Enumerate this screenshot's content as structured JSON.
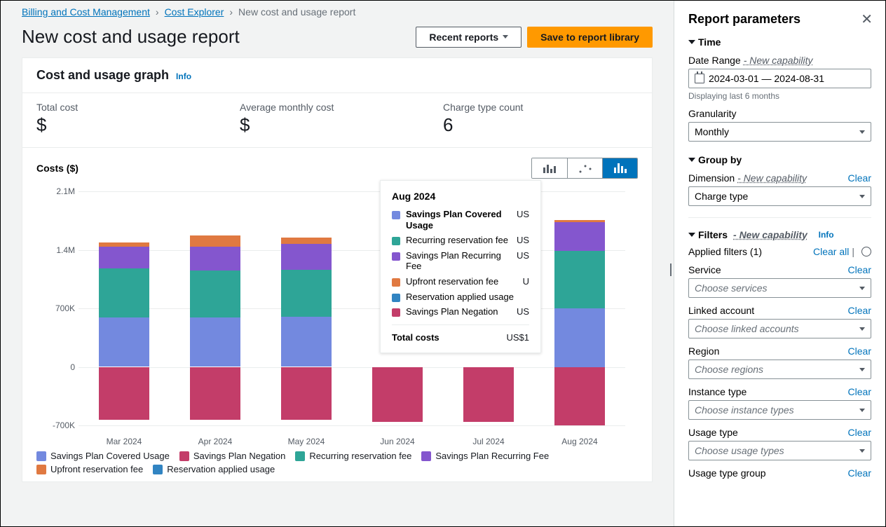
{
  "breadcrumb": {
    "root": "Billing and Cost Management",
    "mid": "Cost Explorer",
    "cur": "New cost and usage report"
  },
  "page": {
    "title": "New cost and usage report",
    "recent_btn": "Recent reports",
    "save_btn": "Save to report library"
  },
  "card": {
    "title": "Cost and usage graph",
    "info": "Info"
  },
  "kpis": [
    {
      "lab": "Total cost",
      "val": "$"
    },
    {
      "lab": "Average monthly cost",
      "val": "$"
    },
    {
      "lab": "Charge type count",
      "val": "6"
    }
  ],
  "chart": {
    "ytitle": "Costs ($)"
  },
  "chart_data": {
    "type": "bar",
    "stacked": true,
    "ylabel": "Costs ($)",
    "xlabel": "",
    "ylim": [
      -700000,
      2100000
    ],
    "yticks": [
      -700000,
      0,
      700000,
      1400000,
      2100000
    ],
    "ytick_labels": [
      "-700K",
      "0",
      "700K",
      "1.4M",
      "2.1M"
    ],
    "categories": [
      "Mar 2024",
      "Apr 2024",
      "May 2024",
      "Jun 2024",
      "Jul 2024",
      "Aug 2024"
    ],
    "series": [
      {
        "name": "Savings Plan Covered Usage",
        "color": "#7389df",
        "values": [
          590000,
          590000,
          600000,
          0,
          0,
          700000
        ]
      },
      {
        "name": "Savings Plan Negation",
        "color": "#c33d69",
        "values": [
          -630000,
          -630000,
          -630000,
          -660000,
          -660000,
          -700000
        ]
      },
      {
        "name": "Recurring reservation fee",
        "color": "#2ea597",
        "values": [
          590000,
          560000,
          560000,
          0,
          0,
          690000
        ]
      },
      {
        "name": "Savings Plan Recurring Fee",
        "color": "#8456ce",
        "values": [
          260000,
          290000,
          310000,
          0,
          0,
          340000
        ]
      },
      {
        "name": "Upfront reservation fee",
        "color": "#e07941",
        "values": [
          50000,
          130000,
          80000,
          0,
          0,
          30000
        ]
      },
      {
        "name": "Reservation applied usage",
        "color": "#3184c2",
        "values": [
          0,
          0,
          0,
          0,
          0,
          0
        ]
      }
    ]
  },
  "tooltip": {
    "title": "Aug 2024",
    "rows": [
      {
        "swatch": "#7389df",
        "lbl": "Savings Plan Covered Usage",
        "v": "US",
        "bold": true
      },
      {
        "swatch": "#2ea597",
        "lbl": "Recurring reservation fee",
        "v": "US"
      },
      {
        "swatch": "#8456ce",
        "lbl": "Savings Plan Recurring Fee",
        "v": "US"
      },
      {
        "swatch": "#e07941",
        "lbl": "Upfront reservation fee",
        "v": "U"
      },
      {
        "swatch": "#3184c2",
        "lbl": "Reservation applied usage",
        "v": ""
      },
      {
        "swatch": "#c33d69",
        "lbl": "Savings Plan Negation",
        "v": "US"
      }
    ],
    "total_lbl": "Total costs",
    "total_val": "US$1"
  },
  "params": {
    "title": "Report parameters",
    "time_h": "Time",
    "date_lbl": "Date Range",
    "date_new": " - New capability",
    "date_val": "2024-03-01 — 2024-08-31",
    "date_hint": "Displaying last 6 months",
    "gran_lbl": "Granularity",
    "gran_val": "Monthly",
    "group_h": "Group by",
    "dim_lbl": "Dimension",
    "dim_new": " - New capability",
    "dim_clear": "Clear",
    "dim_val": "Charge type",
    "filt_h": "Filters",
    "filt_new": " - New capability",
    "filt_info": "Info",
    "applied": "Applied filters (1)",
    "clear_all": "Clear all",
    "filters": [
      {
        "lbl": "Service",
        "ph": "Choose services"
      },
      {
        "lbl": "Linked account",
        "ph": "Choose linked accounts"
      },
      {
        "lbl": "Region",
        "ph": "Choose regions"
      },
      {
        "lbl": "Instance type",
        "ph": "Choose instance types"
      },
      {
        "lbl": "Usage type",
        "ph": "Choose usage types"
      }
    ],
    "last_lbl": "Usage type group",
    "clear": "Clear"
  }
}
